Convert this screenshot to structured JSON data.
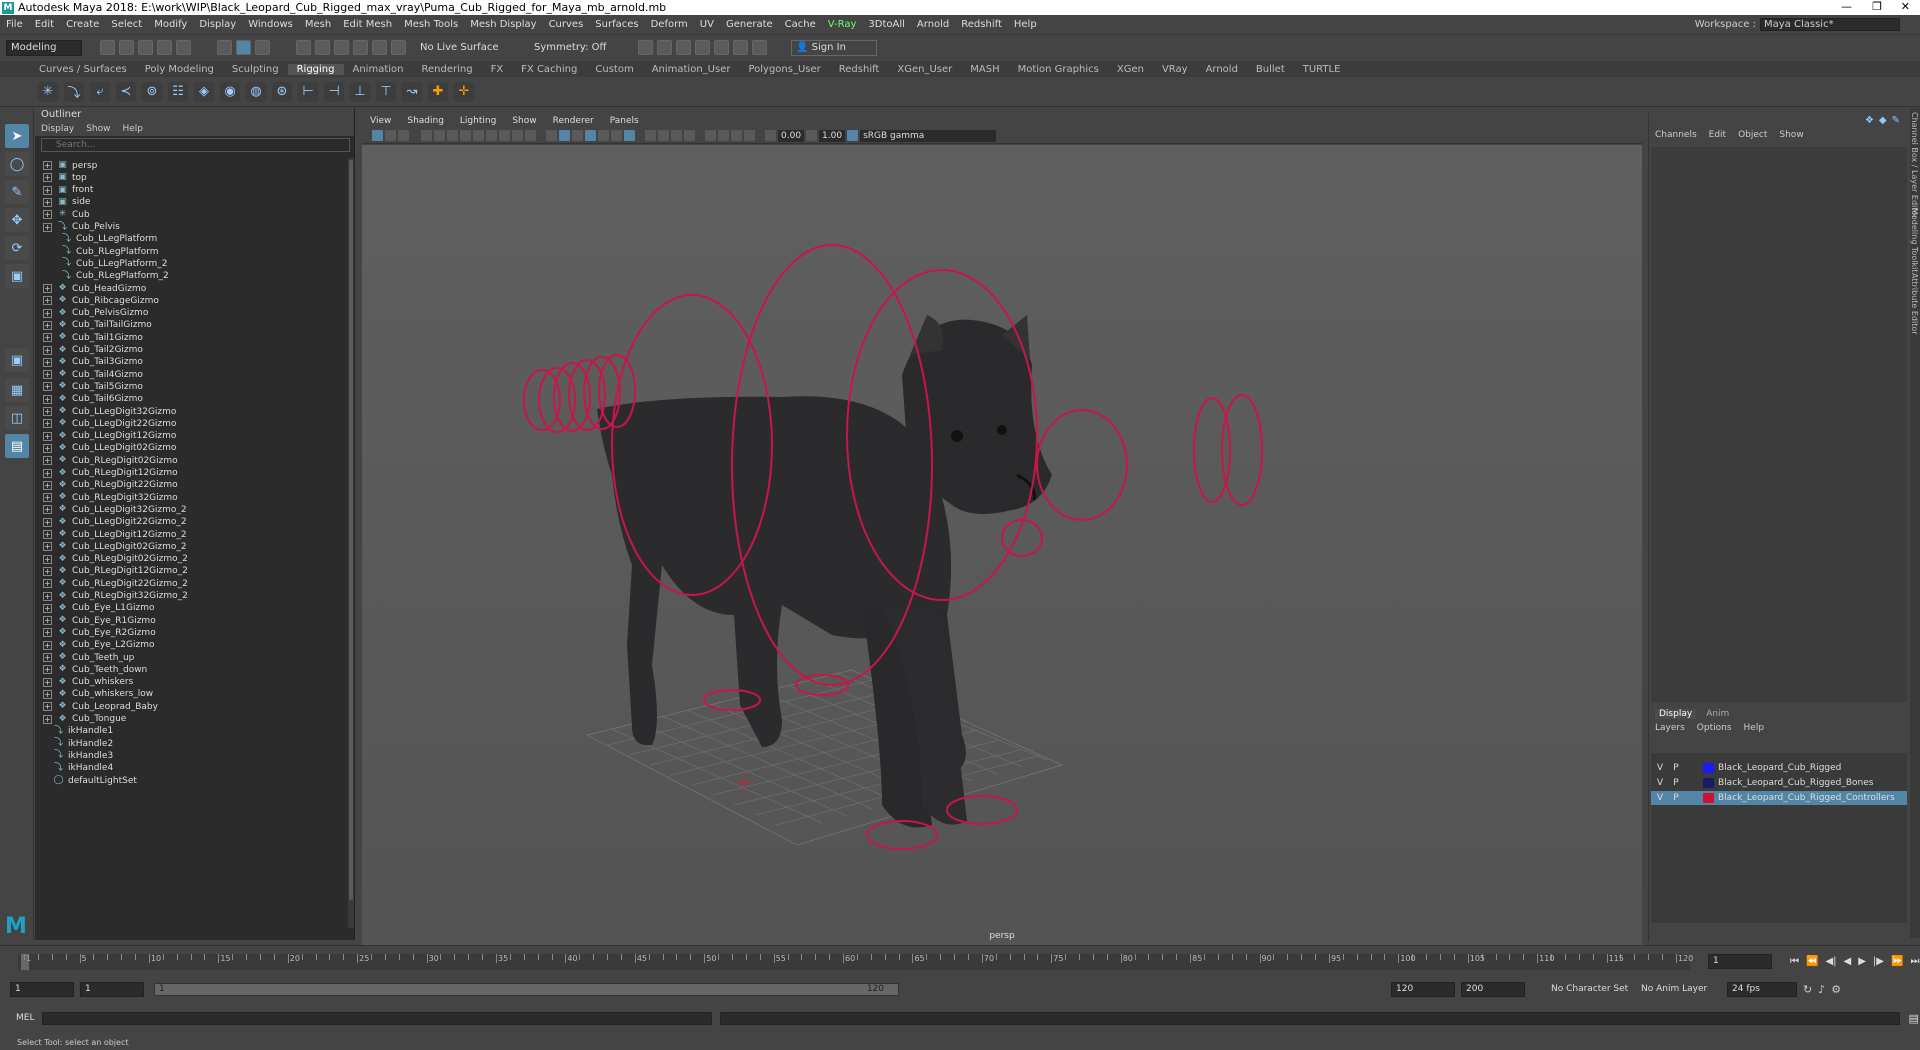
{
  "window": {
    "title": "Autodesk Maya 2018: E:\\work\\WIP\\Black_Leopard_Cub_Rigged_max_vray\\Puma_Cub_Rigged_for_Maya_mb_arnold.mb"
  },
  "menubar": [
    "File",
    "Edit",
    "Create",
    "Select",
    "Modify",
    "Display",
    "Windows",
    "Mesh",
    "Edit Mesh",
    "Mesh Tools",
    "Mesh Display",
    "Curves",
    "Surfaces",
    "Deform",
    "UV",
    "Generate",
    "Cache",
    "V-Ray",
    "3DtoAll",
    "Arnold",
    "Redshift",
    "Help"
  ],
  "workspace": {
    "label": "Workspace :",
    "value": "Maya Classic*"
  },
  "statusline": {
    "mode": "Modeling",
    "live_surface": "No Live Surface",
    "symmetry": "Symmetry: Off",
    "signin": "Sign In"
  },
  "shelf_tabs": [
    "Curves / Surfaces",
    "Poly Modeling",
    "Sculpting",
    "Rigging",
    "Animation",
    "Rendering",
    "FX",
    "FX Caching",
    "Custom",
    "Animation_User",
    "Polygons_User",
    "Redshift",
    "XGen_User",
    "MASH",
    "Motion Graphics",
    "XGen",
    "VRay",
    "Arnold",
    "Bullet",
    "TURTLE"
  ],
  "shelf_active": "Rigging",
  "outliner": {
    "title": "Outliner",
    "menu": [
      "Display",
      "Show",
      "Help"
    ],
    "search_placeholder": "Search...",
    "items": [
      {
        "label": "persp",
        "icon": "camera-icon"
      },
      {
        "label": "top",
        "icon": "camera-icon"
      },
      {
        "label": "front",
        "icon": "camera-icon"
      },
      {
        "label": "side",
        "icon": "camera-icon"
      },
      {
        "label": "Cub",
        "icon": "joint-icon"
      },
      {
        "label": "Cub_Pelvis",
        "icon": "ik-icon"
      },
      {
        "label": "Cub_LLegPlatform",
        "icon": "ik-icon",
        "indent": 1
      },
      {
        "label": "Cub_RLegPlatform",
        "icon": "ik-icon",
        "indent": 1
      },
      {
        "label": "Cub_LLegPlatform_2",
        "icon": "ik-icon",
        "indent": 1
      },
      {
        "label": "Cub_RLegPlatform_2",
        "icon": "ik-icon",
        "indent": 1
      },
      {
        "label": "Cub_HeadGizmo",
        "icon": "gizmo-icon"
      },
      {
        "label": "Cub_RibcageGizmo",
        "icon": "gizmo-icon"
      },
      {
        "label": "Cub_PelvisGizmo",
        "icon": "gizmo-icon"
      },
      {
        "label": "Cub_TailTailGizmo",
        "icon": "gizmo-icon"
      },
      {
        "label": "Cub_Tail1Gizmo",
        "icon": "gizmo-icon"
      },
      {
        "label": "Cub_Tail2Gizmo",
        "icon": "gizmo-icon"
      },
      {
        "label": "Cub_Tail3Gizmo",
        "icon": "gizmo-icon"
      },
      {
        "label": "Cub_Tail4Gizmo",
        "icon": "gizmo-icon"
      },
      {
        "label": "Cub_Tail5Gizmo",
        "icon": "gizmo-icon"
      },
      {
        "label": "Cub_Tail6Gizmo",
        "icon": "gizmo-icon"
      },
      {
        "label": "Cub_LLegDigit32Gizmo",
        "icon": "gizmo-icon"
      },
      {
        "label": "Cub_LLegDigit22Gizmo",
        "icon": "gizmo-icon"
      },
      {
        "label": "Cub_LLegDigit12Gizmo",
        "icon": "gizmo-icon"
      },
      {
        "label": "Cub_LLegDigit02Gizmo",
        "icon": "gizmo-icon"
      },
      {
        "label": "Cub_RLegDigit02Gizmo",
        "icon": "gizmo-icon"
      },
      {
        "label": "Cub_RLegDigit12Gizmo",
        "icon": "gizmo-icon"
      },
      {
        "label": "Cub_RLegDigit22Gizmo",
        "icon": "gizmo-icon"
      },
      {
        "label": "Cub_RLegDigit32Gizmo",
        "icon": "gizmo-icon"
      },
      {
        "label": "Cub_LLegDigit32Gizmo_2",
        "icon": "gizmo-icon"
      },
      {
        "label": "Cub_LLegDigit22Gizmo_2",
        "icon": "gizmo-icon"
      },
      {
        "label": "Cub_LLegDigit12Gizmo_2",
        "icon": "gizmo-icon"
      },
      {
        "label": "Cub_LLegDigit02Gizmo_2",
        "icon": "gizmo-icon"
      },
      {
        "label": "Cub_RLegDigit02Gizmo_2",
        "icon": "gizmo-icon"
      },
      {
        "label": "Cub_RLegDigit12Gizmo_2",
        "icon": "gizmo-icon"
      },
      {
        "label": "Cub_RLegDigit22Gizmo_2",
        "icon": "gizmo-icon"
      },
      {
        "label": "Cub_RLegDigit32Gizmo_2",
        "icon": "gizmo-icon"
      },
      {
        "label": "Cub_Eye_L1Gizmo",
        "icon": "gizmo-icon"
      },
      {
        "label": "Cub_Eye_R1Gizmo",
        "icon": "gizmo-icon"
      },
      {
        "label": "Cub_Eye_R2Gizmo",
        "icon": "gizmo-icon"
      },
      {
        "label": "Cub_Eye_L2Gizmo",
        "icon": "gizmo-icon"
      },
      {
        "label": "Cub_Teeth_up",
        "icon": "gizmo-icon"
      },
      {
        "label": "Cub_Teeth_down",
        "icon": "gizmo-icon"
      },
      {
        "label": "Cub_whiskers",
        "icon": "gizmo-icon"
      },
      {
        "label": "Cub_whiskers_low",
        "icon": "gizmo-icon"
      },
      {
        "label": "Cub_Leoprad_Baby",
        "icon": "gizmo-icon"
      },
      {
        "label": "Cub_Tongue",
        "icon": "gizmo-icon"
      },
      {
        "label": "ikHandle1",
        "icon": "ik-icon",
        "noexp": true
      },
      {
        "label": "ikHandle2",
        "icon": "ik-icon",
        "noexp": true
      },
      {
        "label": "ikHandle3",
        "icon": "ik-icon",
        "noexp": true
      },
      {
        "label": "ikHandle4",
        "icon": "ik-icon",
        "noexp": true
      },
      {
        "label": "defaultLightSet",
        "icon": "set-icon",
        "noexp": true
      }
    ]
  },
  "viewport": {
    "menu": [
      "View",
      "Shading",
      "Lighting",
      "Show",
      "Renderer",
      "Panels"
    ],
    "field1": "0.00",
    "field2": "1.00",
    "color_space": "sRGB gamma",
    "camera_label": "persp"
  },
  "channelbox": {
    "menu": [
      "Channels",
      "Edit",
      "Object",
      "Show"
    ]
  },
  "layer_editor": {
    "tabs": [
      "Display",
      "Anim"
    ],
    "menu": [
      "Layers",
      "Options",
      "Help"
    ],
    "layers": [
      {
        "v": "V",
        "p": "P",
        "name": "Black_Leopard_Cub_Rigged",
        "color": "#1a1aff",
        "selected": false
      },
      {
        "v": "V",
        "p": "P",
        "name": "Black_Leopard_Cub_Rigged_Bones",
        "color": "#1a1a66",
        "selected": false
      },
      {
        "v": "V",
        "p": "P",
        "name": "Black_Leopard_Cub_Rigged_Controllers",
        "color": "#cc1133",
        "selected": true
      }
    ]
  },
  "side_tabs": [
    "Channel Box / Layer Editor",
    "Modeling Toolkit",
    "Attribute Editor"
  ],
  "timeline": {
    "ticks": [
      "1",
      "5",
      "10",
      "15",
      "20",
      "25",
      "30",
      "35",
      "40",
      "45",
      "50",
      "55",
      "60",
      "65",
      "70",
      "75",
      "80",
      "85",
      "90",
      "95",
      "100",
      "105",
      "110",
      "115",
      "120"
    ],
    "current_frame": "1"
  },
  "range": {
    "start": "1",
    "start2": "1",
    "bar_start": "1",
    "bar_end": "120",
    "end": "120",
    "end2": "200",
    "character_set": "No Character Set",
    "anim_layer": "No Anim Layer",
    "fps": "24 fps"
  },
  "cmdline": {
    "label": "MEL"
  },
  "helpline": {
    "text": "Select Tool: select an object"
  }
}
